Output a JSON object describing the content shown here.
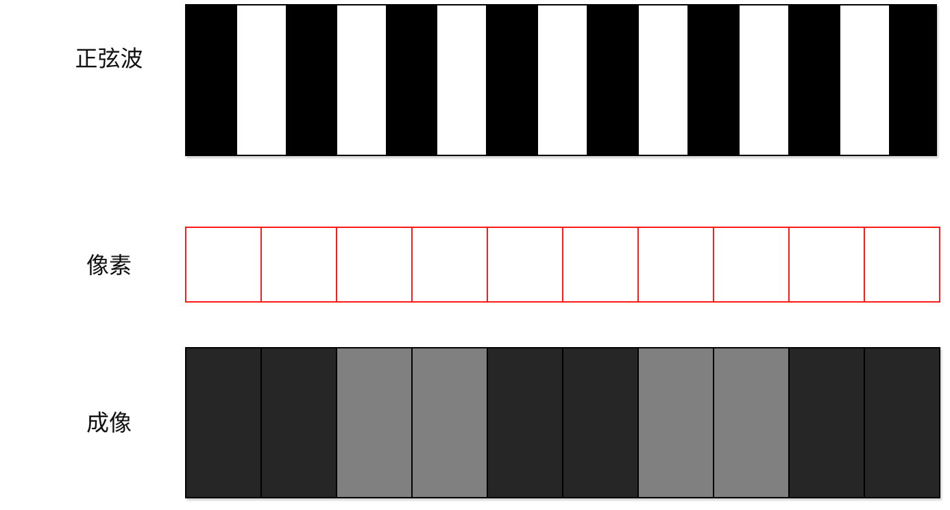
{
  "labels": {
    "wave": "正弦波",
    "pixels": "像素",
    "image": "成像"
  },
  "wave": {
    "stripes": [
      "black",
      "white",
      "black",
      "white",
      "black",
      "white",
      "black",
      "white",
      "black",
      "white",
      "black",
      "white",
      "black",
      "white",
      "black"
    ],
    "colors": {
      "black": "#000000",
      "white": "#ffffff"
    }
  },
  "pixels": {
    "count": 10,
    "border_color": "#ff1a1a"
  },
  "image": {
    "cells": [
      "dark",
      "dark",
      "gray",
      "gray",
      "dark",
      "dark",
      "gray",
      "gray",
      "dark",
      "dark"
    ],
    "colors": {
      "dark": "#262626",
      "gray": "#808080"
    }
  }
}
